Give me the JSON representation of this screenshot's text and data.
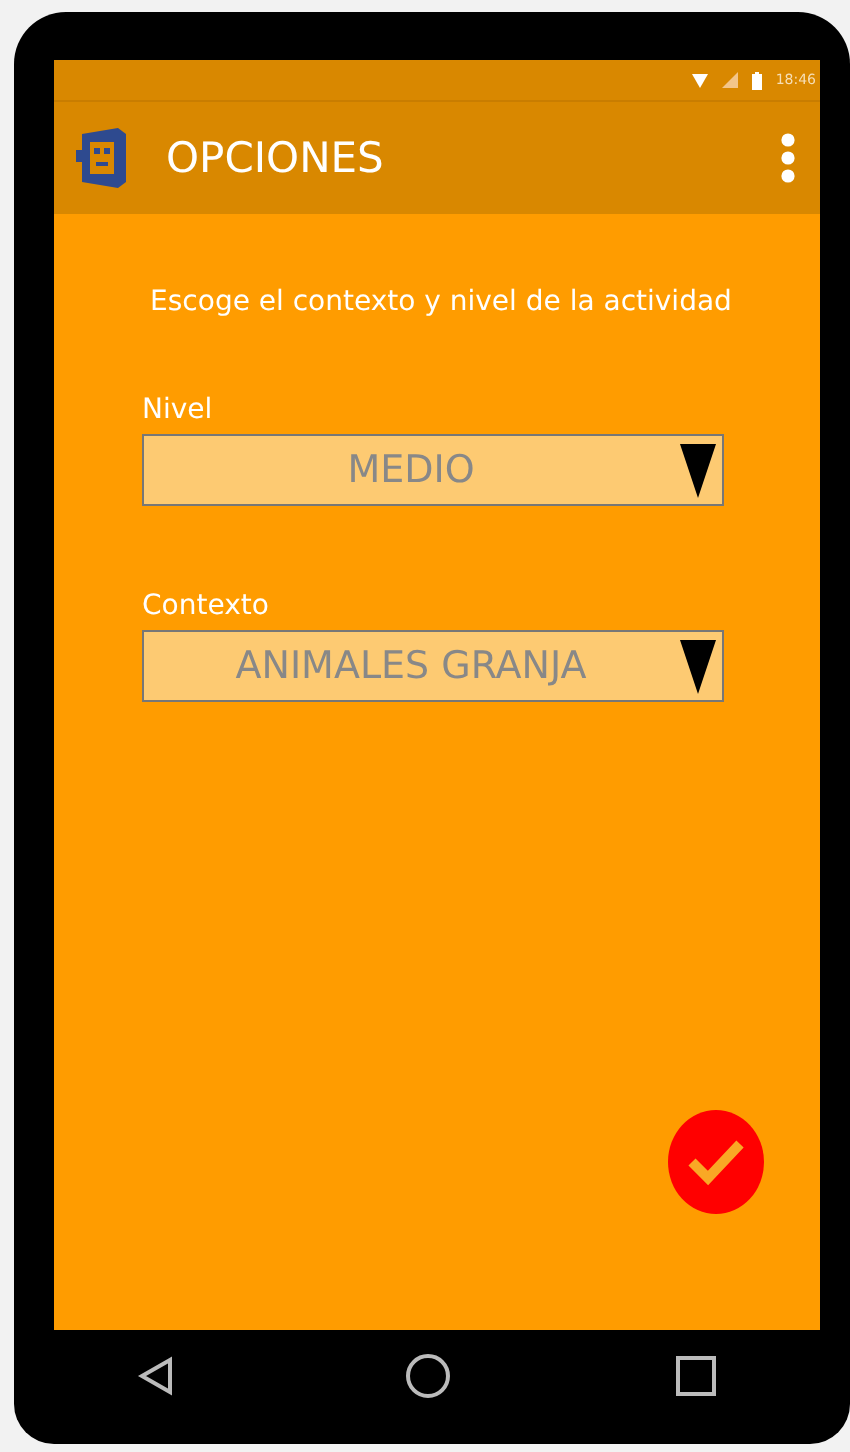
{
  "status_bar": {
    "time": "18:46"
  },
  "app_bar": {
    "title": "OPCIONES"
  },
  "instruction": "Escoge el contexto y nivel de la actividad",
  "fields": [
    {
      "label": "Nivel",
      "value": "MEDIO"
    },
    {
      "label": "Contexto",
      "value": "ANIMALES GRANJA"
    }
  ]
}
